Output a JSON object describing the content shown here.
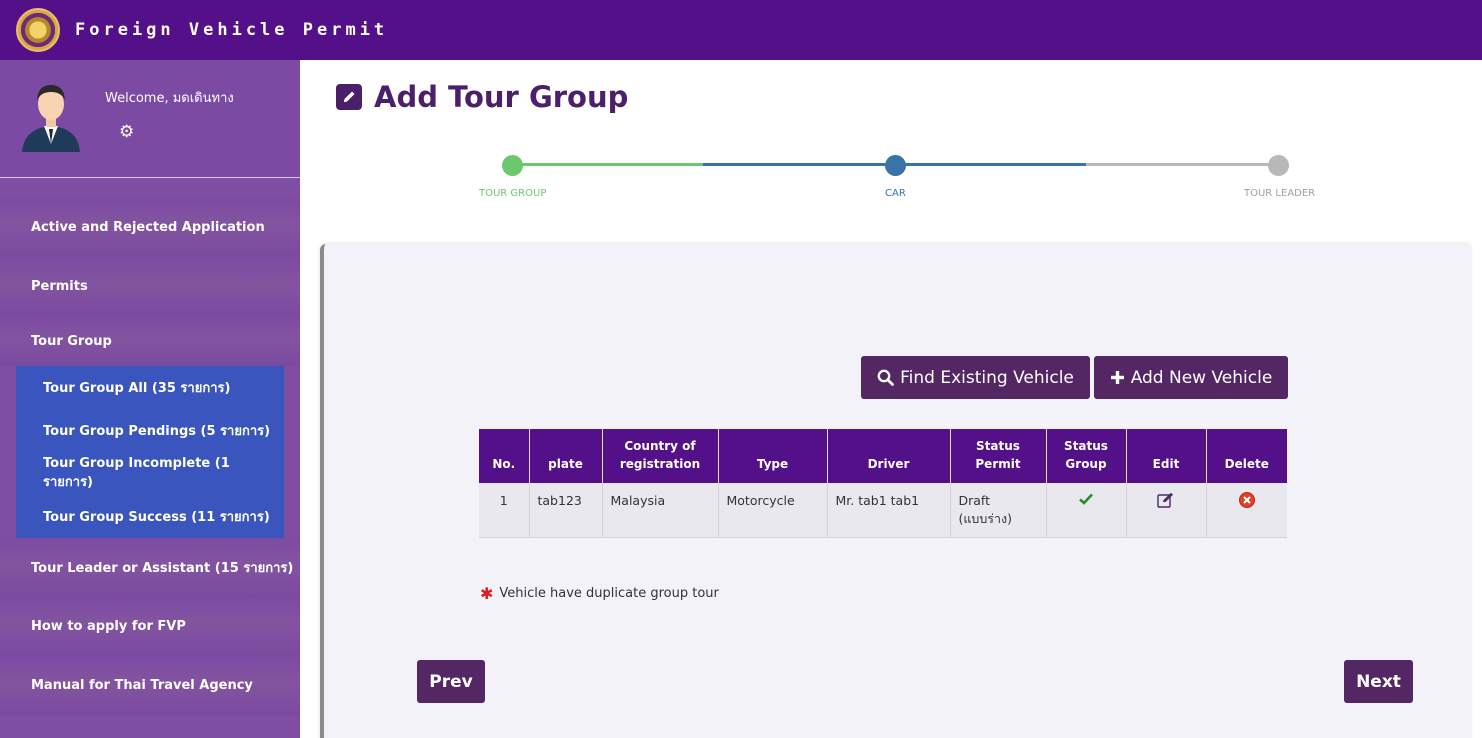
{
  "app": {
    "title": "Foreign Vehicle Permit"
  },
  "user": {
    "welcome": "Welcome, มดเดินทาง"
  },
  "sidebar": {
    "items": [
      {
        "label": "Active and Rejected Application"
      },
      {
        "label": "Permits"
      },
      {
        "label": "Tour Group"
      }
    ],
    "sub_items": [
      {
        "label": "Tour Group All (35 รายการ)"
      },
      {
        "label": "Tour Group Pendings (5 รายการ)"
      },
      {
        "label": "Tour Group Incomplete (1 รายการ)"
      },
      {
        "label": "Tour Group Success (11 รายการ)"
      }
    ],
    "items_after": [
      {
        "label": "Tour Leader or Assistant (15 รายการ)"
      },
      {
        "label": "How to apply for FVP"
      },
      {
        "label": "Manual for Thai Travel Agency"
      }
    ]
  },
  "page": {
    "title": "Add Tour Group"
  },
  "stepper": {
    "steps": [
      {
        "label": "TOUR GROUP",
        "status": "done"
      },
      {
        "label": "CAR",
        "status": "active"
      },
      {
        "label": "TOUR LEADER",
        "status": "pending"
      }
    ],
    "colors": {
      "done": "#6cc86c",
      "active": "#3a73a8",
      "pending": "#b8b8b8"
    }
  },
  "actions": {
    "find_label": "Find Existing Vehicle",
    "add_label": "Add New Vehicle",
    "prev_label": "Prev",
    "next_label": "Next"
  },
  "table": {
    "headers": {
      "no": "No.",
      "plate": "plate",
      "country_1": "Country of",
      "country_2": "registration",
      "type": "Type",
      "driver": "Driver",
      "status_permit_1": "Status",
      "status_permit_2": "Permit",
      "status_group_1": "Status",
      "status_group_2": "Group",
      "edit": "Edit",
      "delete": "Delete"
    },
    "rows": [
      {
        "no": "1",
        "plate": "tab123",
        "country": "Malaysia",
        "type": "Motorcycle",
        "driver": "Mr. tab1 tab1",
        "status_permit_1": "Draft",
        "status_permit_2": "(แบบร่าง)",
        "status_group_icon": "check-icon"
      }
    ]
  },
  "note": {
    "text": "Vehicle have duplicate group tour"
  },
  "colors": {
    "brand": "#531088",
    "accent": "#532763",
    "sub_nav": "#3a55bd"
  }
}
